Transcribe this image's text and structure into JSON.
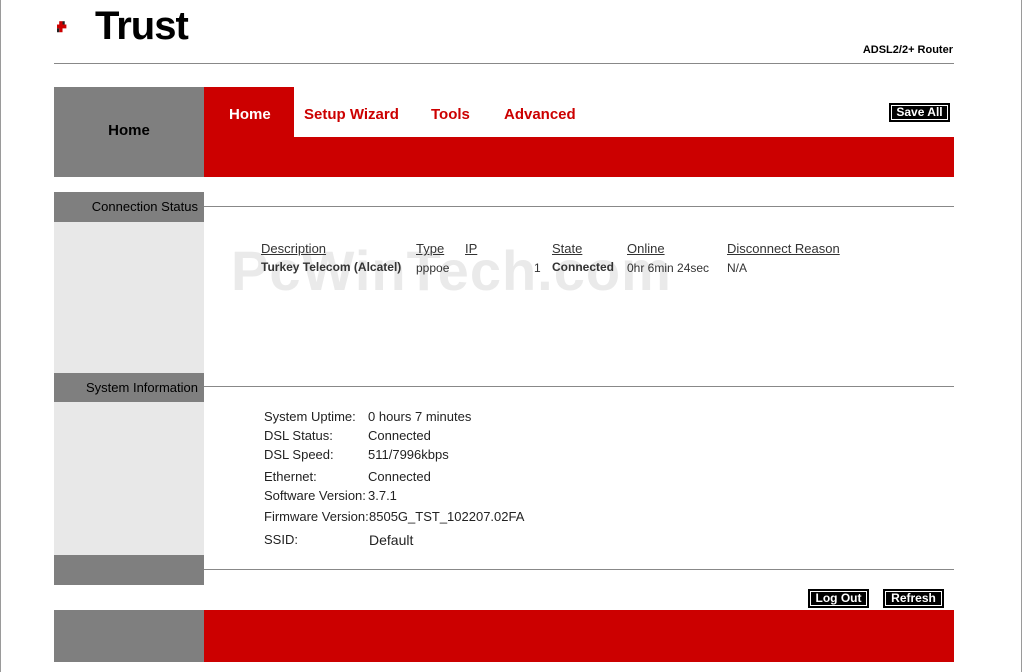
{
  "header": {
    "brand": "Trust",
    "product": "ADSL2/2+ Router"
  },
  "nav": {
    "section_title": "Home",
    "tabs": [
      {
        "label": "Home",
        "active": true
      },
      {
        "label": "Setup Wizard",
        "active": false
      },
      {
        "label": "Tools",
        "active": false
      },
      {
        "label": "Advanced",
        "active": false
      }
    ],
    "save_all": "Save All"
  },
  "connection_status": {
    "title": "Connection Status",
    "columns": [
      "Description",
      "Type",
      "IP",
      "State",
      "Online",
      "Disconnect Reason"
    ],
    "rows": [
      {
        "description": "Turkey Telecom (Alcatel)",
        "type": "pppoe",
        "ip": "1",
        "state": "Connected",
        "online": "0hr 6min 24sec",
        "reason": "N/A"
      }
    ]
  },
  "watermark": "PcWinTech.com",
  "system_information": {
    "title": "System Information",
    "items": [
      {
        "label": "System Uptime:",
        "value": "0 hours 7 minutes"
      },
      {
        "label": "DSL Status:",
        "value": "Connected"
      },
      {
        "label": "DSL Speed:",
        "value": "511/7996kbps"
      },
      {
        "label": "Ethernet:",
        "value": "Connected"
      },
      {
        "label": "Software Version:",
        "value": "3.7.1"
      },
      {
        "label": "Firmware Version:",
        "value": "8505G_TST_102207.02FA"
      },
      {
        "label": "SSID:",
        "value": "Default"
      }
    ]
  },
  "footer": {
    "logout": "Log Out",
    "refresh": "Refresh"
  },
  "colors": {
    "brand_red": "#cc0000",
    "side_grey": "#7f7f7f",
    "panel_grey": "#e8e8e8"
  }
}
